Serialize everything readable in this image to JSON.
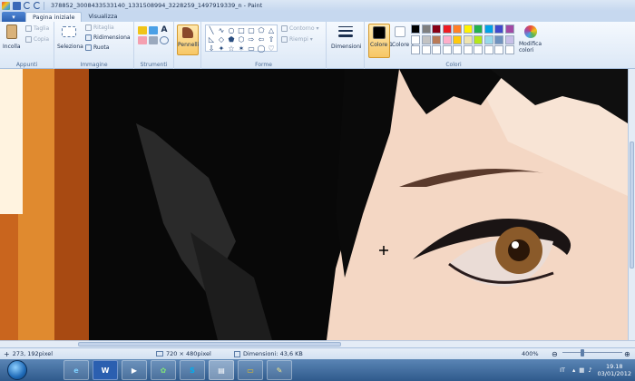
{
  "window": {
    "title": "378852_3008433533140_1331508994_3228259_1497919339_n - Paint"
  },
  "tabs": [
    {
      "label": "Pagina iniziale",
      "active": true
    },
    {
      "label": "Visualizza",
      "active": false
    }
  ],
  "ribbon": {
    "clipboard": {
      "paste": "Incolla",
      "cut": "Taglia",
      "copy": "Copia",
      "label": "Appunti"
    },
    "image": {
      "select": "Seleziona",
      "crop": "Ritaglia",
      "resize": "Ridimensiona",
      "rotate": "Ruota",
      "label": "Immagine"
    },
    "tools": {
      "label": "Strumenti"
    },
    "brushes": {
      "label": "Pennelli"
    },
    "shapes": {
      "outline": "Contorno",
      "fill": "Riempi",
      "label": "Forme"
    },
    "size": {
      "label": "Dimensioni"
    },
    "colors": {
      "color1": "Colore 1",
      "color2": "Colore 2",
      "edit": "Modifica colori",
      "label": "Colori",
      "color1_value": "#000000",
      "color2_value": "#ffffff",
      "palette": [
        "#000000",
        "#7f7f7f",
        "#880015",
        "#ed1c24",
        "#ff7f27",
        "#fff200",
        "#22b14c",
        "#00a2e8",
        "#3f48cc",
        "#a349a4",
        "#ffffff",
        "#c3c3c3",
        "#b97a57",
        "#ffaec9",
        "#ffc90e",
        "#efe4b0",
        "#b5e61d",
        "#99d9ea",
        "#7092be",
        "#c8bfe7",
        "#ffffff",
        "#ffffff",
        "#ffffff",
        "#ffffff",
        "#ffffff",
        "#ffffff",
        "#ffffff",
        "#ffffff",
        "#ffffff",
        "#ffffff"
      ]
    }
  },
  "status": {
    "cursor_pos": "273, 192pixel",
    "image_size": "720 × 480pixel",
    "file_size": "Dimensioni: 43,6 KB",
    "zoom": "400%"
  },
  "taskbar": {
    "apps": [
      "ie-icon",
      "word-icon",
      "media-player-icon",
      "messenger-icon",
      "skype-icon",
      "paint-icon",
      "explorer-icon",
      "sticky-icon"
    ],
    "active_app": "paint-icon",
    "lang": "IT",
    "time": "19.18",
    "date": "03/01/2012"
  }
}
